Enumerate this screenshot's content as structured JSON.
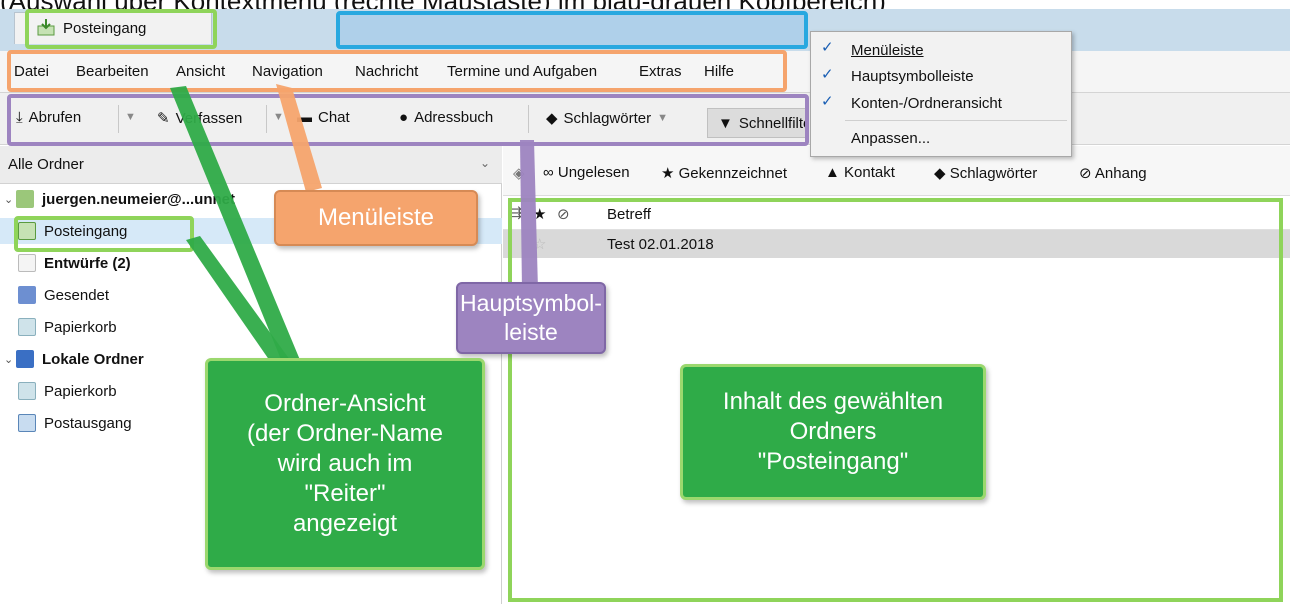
{
  "caption": "(Auswahl über Kontextmenü (rechte Maustaste) im blau-grauen Kopfbereich)",
  "tab": {
    "label": "Posteingang"
  },
  "menubar": {
    "items": [
      "Datei",
      "Bearbeiten",
      "Ansicht",
      "Navigation",
      "Nachricht",
      "Termine und Aufgaben",
      "Extras",
      "Hilfe"
    ]
  },
  "toolbar": {
    "get_messages": "Abrufen",
    "write": "Verfassen",
    "chat": "Chat",
    "address_book": "Adressbuch",
    "tags": "Schlagwörter",
    "quick_filter": "Schnellfilter"
  },
  "folder_pane": {
    "header": "Alle Ordner",
    "account": "juergen.neumeier@...unnet",
    "inbox": "Posteingang",
    "drafts": "Entwürfe (2)",
    "sent": "Gesendet",
    "trash": "Papierkorb",
    "local_folders": "Lokale Ordner",
    "local_trash": "Papierkorb",
    "outbox": "Postausgang"
  },
  "filter_bar": {
    "unread": "Ungelesen",
    "starred": "Gekennzeichnet",
    "contact": "Kontakt",
    "tags": "Schlagwörter",
    "attachment": "Anhang"
  },
  "message_list": {
    "subject_header": "Betreff",
    "rows": [
      {
        "subject": "Test 02.01.2018"
      }
    ]
  },
  "context_menu": {
    "items": [
      {
        "label": "Menüleiste",
        "checked": true
      },
      {
        "label": "Hauptsymbolleiste",
        "checked": true
      },
      {
        "label": "Konten-/Ordneransicht",
        "checked": true
      },
      {
        "label": "Anpassen...",
        "checked": false
      }
    ]
  },
  "annotations": {
    "menubar": "Menüleiste",
    "toolbar": "Hauptsymbol-\nleiste",
    "folder_view": "Ordner-Ansicht\n(der Ordner-Name\nwird auch im\n\"Reiter\"\nangezeigt",
    "content": "Inhalt des gewählten\nOrdners\n\"Posteingang\""
  },
  "colors": {
    "tabbar": "#c8dceb",
    "tab_highlight": "#afd0ea",
    "frame_green": "#8fd45a",
    "frame_orange": "#f5a46d",
    "frame_purple": "#9d84c0",
    "frame_blue": "#28a8e0",
    "callout_green": "#2fab48"
  }
}
